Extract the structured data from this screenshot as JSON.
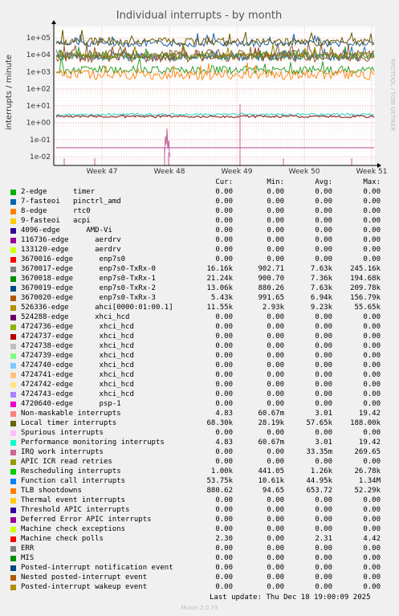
{
  "title": "Individual interrupts - by month",
  "ylabel": "interrupts / minute",
  "side_label": "RRDTOOL / TOBI OETIKER",
  "munin_version": "Munin 2.0.73",
  "last_update": "Last update: Thu Dec 18 19:00:09 2025",
  "headers": {
    "cur": "Cur:",
    "min": "Min:",
    "avg": "Avg:",
    "max": "Max:"
  },
  "chart_data": {
    "type": "line",
    "title": "Individual interrupts - by month",
    "ylabel": "interrupts / minute",
    "yscale": "log",
    "ylim": [
      0.005,
      300000
    ],
    "yticks": [
      "1e-02",
      "1e-01",
      "1e+00",
      "1e+01",
      "1e+02",
      "1e+03",
      "1e+04",
      "1e+05"
    ],
    "xticks": [
      "Week 47",
      "Week 48",
      "Week 49",
      "Week 50",
      "Week 51"
    ],
    "grid": true,
    "series": [
      {
        "name": "Function call interrupts",
        "color": "#1a5fa8",
        "level": 44950
      },
      {
        "name": "Local timer interrupts",
        "color": "#6b5a00",
        "level": 57650
      },
      {
        "name": "3670016-edge enp7s0",
        "color": "#8b5a2b",
        "level": 10000
      },
      {
        "name": "3670017-edge enp7s0-TxRx-0",
        "color": "#1e9e3a",
        "level": 7630
      },
      {
        "name": "3670019-edge enp7s0-TxRx-2",
        "color": "#2a6fb0",
        "level": 7630
      },
      {
        "name": "3670020-edge enp7s0-TxRx-3",
        "color": "#a0522d",
        "level": 6940
      },
      {
        "name": "526336-edge ahci[0000:01:00.1]",
        "color": "#8c8c00",
        "level": 9230
      },
      {
        "name": "Rescheduling interrupts",
        "color": "#2ca02c",
        "level": 1260
      },
      {
        "name": "TLB shootdowns",
        "color": "#ff8c1a",
        "level": 653.72
      },
      {
        "name": "Performance monitoring interrupts",
        "color": "#3cd6c4",
        "level": 3.01
      },
      {
        "name": "Machine check polls",
        "color": "#8b1a1a",
        "level": 2.31
      },
      {
        "name": "IRQ work interrupts",
        "color": "#c0609a",
        "level": 0.03335
      }
    ]
  },
  "legend": [
    {
      "color": "#00b000",
      "name": "2-edge      timer",
      "cur": "0.00",
      "min": "0.00",
      "avg": "0.00",
      "max": "0.00"
    },
    {
      "color": "#0066b3",
      "name": "7-fasteoi   pinctrl_amd",
      "cur": "0.00",
      "min": "0.00",
      "avg": "0.00",
      "max": "0.00"
    },
    {
      "color": "#ff8000",
      "name": "8-edge      rtc0",
      "cur": "0.00",
      "min": "0.00",
      "avg": "0.00",
      "max": "0.00"
    },
    {
      "color": "#ffcc00",
      "name": "9-fasteoi   acpi",
      "cur": "0.00",
      "min": "0.00",
      "avg": "0.00",
      "max": "0.00"
    },
    {
      "color": "#330099",
      "name": "4096-edge      AMD-Vi",
      "cur": "0.00",
      "min": "0.00",
      "avg": "0.00",
      "max": "0.00"
    },
    {
      "color": "#990099",
      "name": "116736-edge      aerdrv",
      "cur": "0.00",
      "min": "0.00",
      "avg": "0.00",
      "max": "0.00"
    },
    {
      "color": "#ccff00",
      "name": "133120-edge      aerdrv",
      "cur": "0.00",
      "min": "0.00",
      "avg": "0.00",
      "max": "0.00"
    },
    {
      "color": "#ff0000",
      "name": "3670016-edge      enp7s0",
      "cur": "0.00",
      "min": "0.00",
      "avg": "0.00",
      "max": "0.00"
    },
    {
      "color": "#808080",
      "name": "3670017-edge      enp7s0-TxRx-0",
      "cur": "16.16k",
      "min": "902.71",
      "avg": "7.63k",
      "max": "245.16k"
    },
    {
      "color": "#008f00",
      "name": "3670018-edge      enp7s0-TxRx-1",
      "cur": "21.24k",
      "min": "900.70",
      "avg": "7.36k",
      "max": "194.68k"
    },
    {
      "color": "#00487d",
      "name": "3670019-edge      enp7s0-TxRx-2",
      "cur": "13.06k",
      "min": "880.26",
      "avg": "7.63k",
      "max": "209.78k"
    },
    {
      "color": "#b35a00",
      "name": "3670020-edge      enp7s0-TxRx-3",
      "cur": "5.43k",
      "min": "991.65",
      "avg": "6.94k",
      "max": "156.79k"
    },
    {
      "color": "#b38f00",
      "name": "526336-edge      ahci[0000:01:00.1]",
      "cur": "11.55k",
      "min": "2.93k",
      "avg": "9.23k",
      "max": "55.65k"
    },
    {
      "color": "#6b006b",
      "name": "524288-edge      xhci_hcd",
      "cur": "0.00",
      "min": "0.00",
      "avg": "0.00",
      "max": "0.00"
    },
    {
      "color": "#8fb300",
      "name": "4724736-edge      xhci_hcd",
      "cur": "0.00",
      "min": "0.00",
      "avg": "0.00",
      "max": "0.00"
    },
    {
      "color": "#b30000",
      "name": "4724737-edge      xhci_hcd",
      "cur": "0.00",
      "min": "0.00",
      "avg": "0.00",
      "max": "0.00"
    },
    {
      "color": "#bebebe",
      "name": "4724738-edge      xhci_hcd",
      "cur": "0.00",
      "min": "0.00",
      "avg": "0.00",
      "max": "0.00"
    },
    {
      "color": "#80ff80",
      "name": "4724739-edge      xhci_hcd",
      "cur": "0.00",
      "min": "0.00",
      "avg": "0.00",
      "max": "0.00"
    },
    {
      "color": "#80c9ff",
      "name": "4724740-edge      xhci_hcd",
      "cur": "0.00",
      "min": "0.00",
      "avg": "0.00",
      "max": "0.00"
    },
    {
      "color": "#ffc080",
      "name": "4724741-edge      xhci_hcd",
      "cur": "0.00",
      "min": "0.00",
      "avg": "0.00",
      "max": "0.00"
    },
    {
      "color": "#ffe680",
      "name": "4724742-edge      xhci_hcd",
      "cur": "0.00",
      "min": "0.00",
      "avg": "0.00",
      "max": "0.00"
    },
    {
      "color": "#aa80ff",
      "name": "4724743-edge      xhci_hcd",
      "cur": "0.00",
      "min": "0.00",
      "avg": "0.00",
      "max": "0.00"
    },
    {
      "color": "#ee00cc",
      "name": "4720640-edge      psp-1",
      "cur": "0.00",
      "min": "0.00",
      "avg": "0.00",
      "max": "0.00"
    },
    {
      "color": "#ff8080",
      "name": "Non-maskable interrupts",
      "cur": "4.83",
      "min": "60.67m",
      "avg": "3.01",
      "max": "19.42"
    },
    {
      "color": "#666600",
      "name": "Local timer interrupts",
      "cur": "68.30k",
      "min": "28.19k",
      "avg": "57.65k",
      "max": "188.00k"
    },
    {
      "color": "#ffbfff",
      "name": "Spurious interrupts",
      "cur": "0.00",
      "min": "0.00",
      "avg": "0.00",
      "max": "0.00"
    },
    {
      "color": "#00ffcc",
      "name": "Performance monitoring interrupts",
      "cur": "4.83",
      "min": "60.67m",
      "avg": "3.01",
      "max": "19.42"
    },
    {
      "color": "#cc6699",
      "name": "IRQ work interrupts",
      "cur": "0.00",
      "min": "0.00",
      "avg": "33.35m",
      "max": "269.65"
    },
    {
      "color": "#999900",
      "name": "APIC ICR read retries",
      "cur": "0.00",
      "min": "0.00",
      "avg": "0.00",
      "max": "0.00"
    },
    {
      "color": "#00cc00",
      "name": "Rescheduling interrupts",
      "cur": "1.00k",
      "min": "441.05",
      "avg": "1.26k",
      "max": "26.78k"
    },
    {
      "color": "#0080ff",
      "name": "Function call interrupts",
      "cur": "53.75k",
      "min": "10.61k",
      "avg": "44.95k",
      "max": "1.34M"
    },
    {
      "color": "#ff8000",
      "name": "TLB shootdowns",
      "cur": "880.62",
      "min": "94.65",
      "avg": "653.72",
      "max": "52.29k"
    },
    {
      "color": "#ffcc00",
      "name": "Thermal event interrupts",
      "cur": "0.00",
      "min": "0.00",
      "avg": "0.00",
      "max": "0.00"
    },
    {
      "color": "#330099",
      "name": "Threshold APIC interrupts",
      "cur": "0.00",
      "min": "0.00",
      "avg": "0.00",
      "max": "0.00"
    },
    {
      "color": "#990099",
      "name": "Deferred Error APIC interrupts",
      "cur": "0.00",
      "min": "0.00",
      "avg": "0.00",
      "max": "0.00"
    },
    {
      "color": "#ccff00",
      "name": "Machine check exceptions",
      "cur": "0.00",
      "min": "0.00",
      "avg": "0.00",
      "max": "0.00"
    },
    {
      "color": "#ff0000",
      "name": "Machine check polls",
      "cur": "2.30",
      "min": "0.00",
      "avg": "2.31",
      "max": "4.42"
    },
    {
      "color": "#808080",
      "name": "ERR",
      "cur": "0.00",
      "min": "0.00",
      "avg": "0.00",
      "max": "0.00"
    },
    {
      "color": "#008f00",
      "name": "MIS",
      "cur": "0.00",
      "min": "0.00",
      "avg": "0.00",
      "max": "0.00"
    },
    {
      "color": "#00487d",
      "name": "Posted-interrupt notification event",
      "cur": "0.00",
      "min": "0.00",
      "avg": "0.00",
      "max": "0.00"
    },
    {
      "color": "#b35a00",
      "name": "Nested posted-interrupt event",
      "cur": "0.00",
      "min": "0.00",
      "avg": "0.00",
      "max": "0.00"
    },
    {
      "color": "#b38f00",
      "name": "Posted-interrupt wakeup event",
      "cur": "0.00",
      "min": "0.00",
      "avg": "0.00",
      "max": "0.00"
    }
  ]
}
